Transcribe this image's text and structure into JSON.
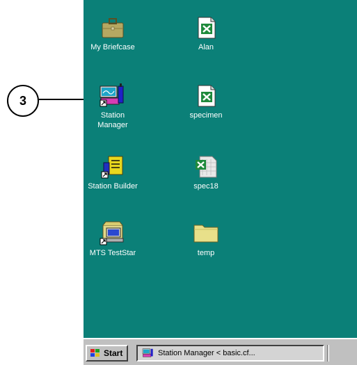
{
  "callout": {
    "number": "3"
  },
  "desktop": {
    "icons": [
      {
        "label": "My Briefcase",
        "icon": "briefcase-icon"
      },
      {
        "label": "Alan",
        "icon": "excel-file-icon"
      },
      {
        "label": "Station\nManager",
        "icon": "station-manager-icon",
        "shortcut": true
      },
      {
        "label": "specimen",
        "icon": "excel-file-icon"
      },
      {
        "label": "Station Builder",
        "icon": "station-builder-icon",
        "shortcut": true
      },
      {
        "label": "spec18",
        "icon": "excel-file-icon"
      },
      {
        "label": "MTS TestStar",
        "icon": "mts-teststar-icon",
        "shortcut": true
      },
      {
        "label": "temp",
        "icon": "folder-icon"
      }
    ]
  },
  "taskbar": {
    "start_label": "Start",
    "tasks": [
      {
        "label": "Station Manager < basic.cf...",
        "icon": "station-manager-icon"
      }
    ]
  },
  "colors": {
    "desktop": "#0b8078",
    "taskbar": "#c0c0c0"
  }
}
